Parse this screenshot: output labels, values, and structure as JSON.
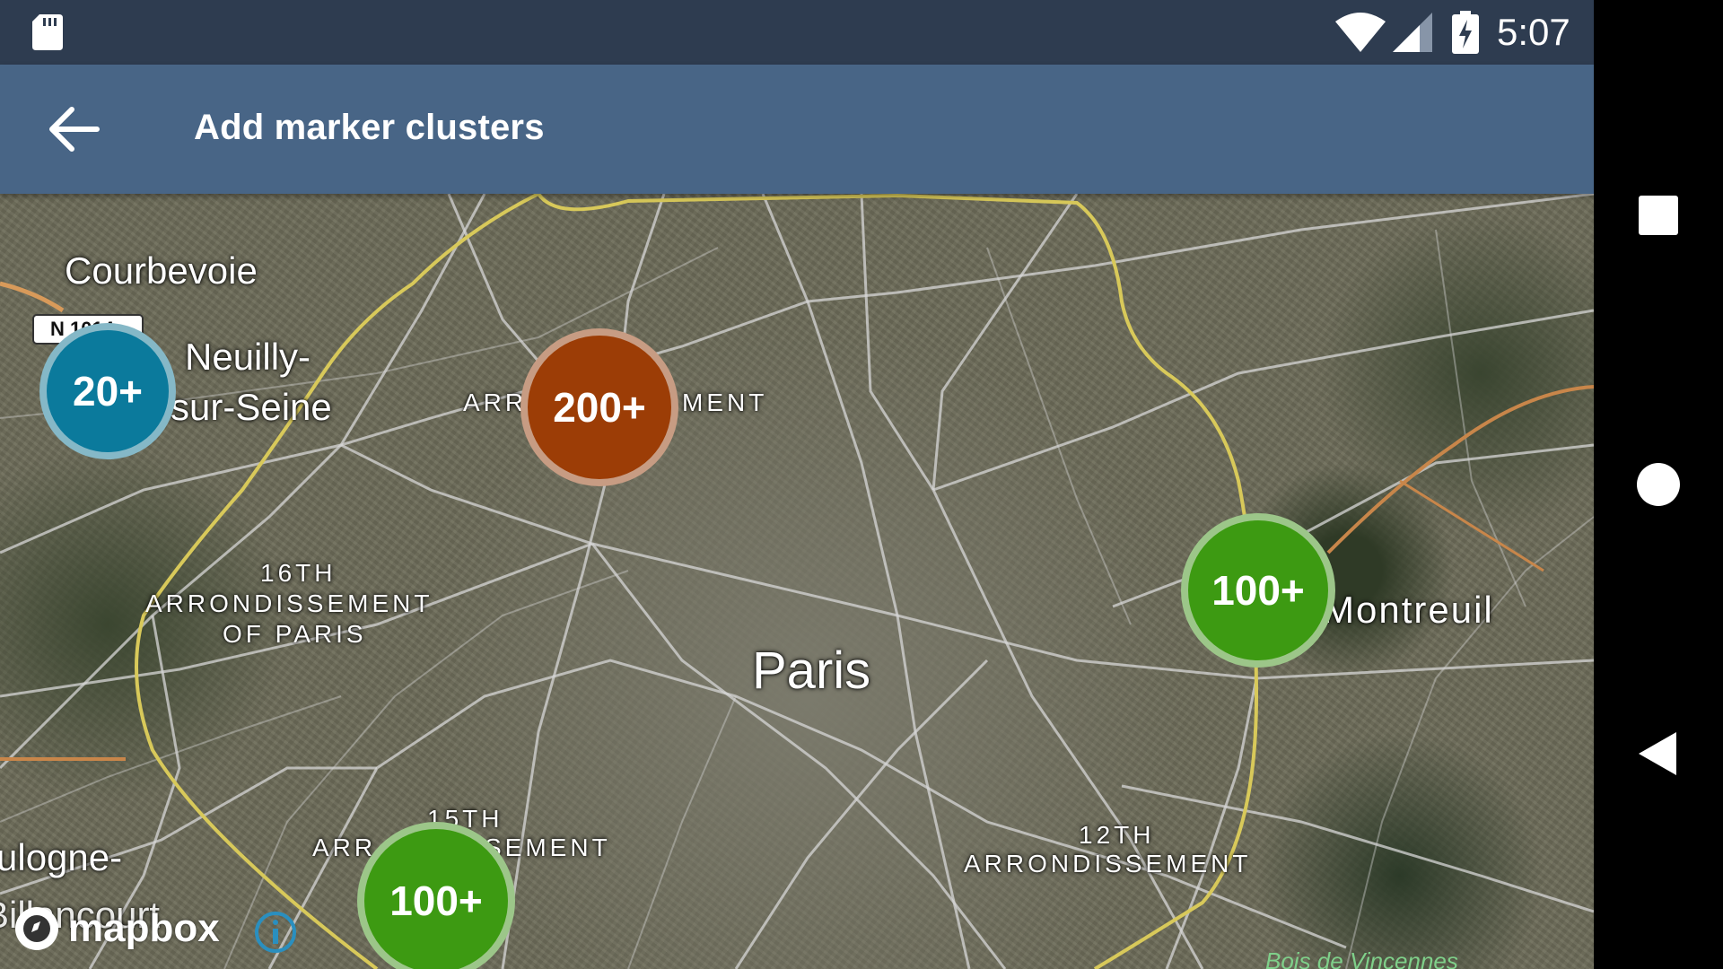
{
  "status_bar": {
    "time": "5:07"
  },
  "app_bar": {
    "title": "Add marker clusters"
  },
  "map": {
    "places": {
      "courbevoie": "Courbevoie",
      "neuilly_1": "Neuilly-",
      "neuilly_2": "sur-Seine",
      "paris": "Paris",
      "montreuil": "Montreuil",
      "boulogne_1": "ulogne-",
      "boulogne_2": "Billancourt"
    },
    "districts": {
      "d16_1": "16TH",
      "d16_2": "ARRONDISSEMENT",
      "d16_3": "OF PARIS",
      "d17_left": "ARR",
      "d17_right": "MENT",
      "d15_1": "15TH",
      "d15_left": "ARR",
      "d15_right": "SEMENT",
      "d12_1": "12TH",
      "d12_2": "ARRONDISSEMENT"
    },
    "road_shield": "N 1014",
    "bois": "Bois de Vincennes",
    "attribution": "mapbox"
  },
  "clusters": [
    {
      "label": "20+",
      "color": "#0b7a9c"
    },
    {
      "label": "200+",
      "color": "#9c3d06"
    },
    {
      "label": "100+",
      "color": "#3d9a12"
    },
    {
      "label": "100+",
      "color": "#3d9a12"
    }
  ],
  "icons": {
    "status": [
      "sd-card-icon",
      "wifi-icon",
      "cellular-signal-icon",
      "battery-charging-icon"
    ],
    "nav": [
      "recents-icon",
      "home-icon",
      "back-triangle-icon"
    ]
  }
}
